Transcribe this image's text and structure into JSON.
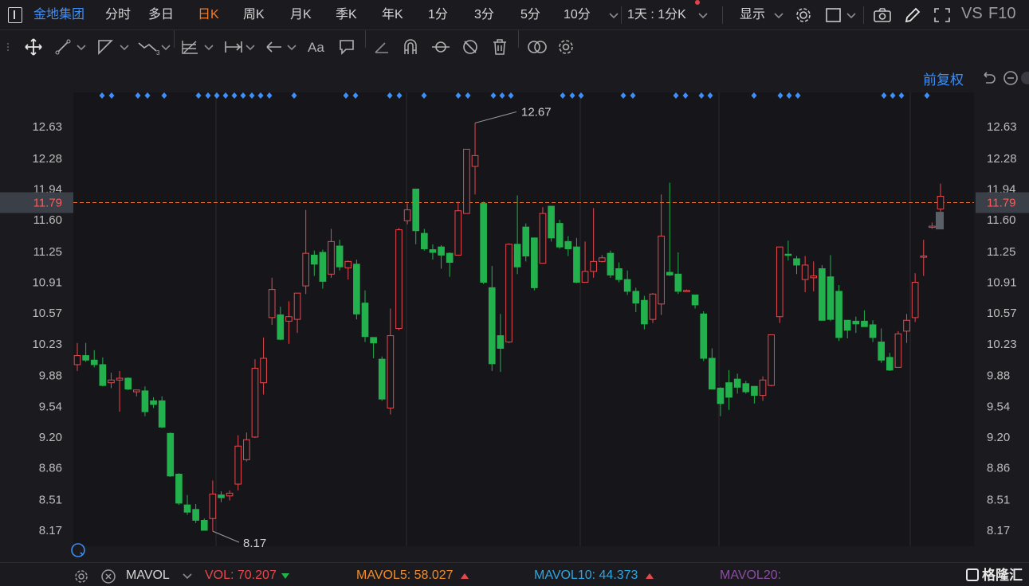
{
  "toolbar": {
    "stock_name": "金地集团",
    "periods": [
      "分时",
      "多日",
      "日K",
      "周K",
      "月K",
      "季K",
      "年K",
      "1分",
      "3分",
      "5分",
      "10分"
    ],
    "active_period": "日K",
    "multi_period": "1天 : 1分K",
    "display_label": "显示",
    "compare_label": "VS",
    "f10_label": "F10"
  },
  "chart_header": {
    "adjust_label": "前复权"
  },
  "chart_data": {
    "type": "candlestick",
    "price_axis_ticks": [
      12.63,
      12.28,
      11.94,
      11.6,
      11.25,
      10.91,
      10.57,
      10.23,
      9.88,
      9.54,
      9.2,
      8.86,
      8.51,
      8.17
    ],
    "ylim": [
      8.17,
      12.63
    ],
    "last_price": "11.79",
    "max_label": "12.67",
    "min_label": "8.17",
    "up_color": "#e5484d",
    "down_color": "#22b14c",
    "candles": [
      [
        10.0,
        10.1,
        9.93,
        10.24
      ],
      [
        10.1,
        10.05,
        10.03,
        10.24
      ],
      [
        10.05,
        10.0,
        9.97,
        10.16
      ],
      [
        10.0,
        9.77,
        9.76,
        10.08
      ],
      [
        9.8,
        9.83,
        9.74,
        9.91
      ],
      [
        9.83,
        9.85,
        9.48,
        9.93
      ],
      [
        9.85,
        9.73,
        9.72,
        9.86
      ],
      [
        9.7,
        9.72,
        9.65,
        9.72
      ],
      [
        9.71,
        9.48,
        9.43,
        9.76
      ],
      [
        9.6,
        9.56,
        9.52,
        9.64
      ],
      [
        9.6,
        9.31,
        9.3,
        9.65
      ],
      [
        9.24,
        8.77,
        8.76,
        9.25
      ],
      [
        8.79,
        8.47,
        8.45,
        8.8
      ],
      [
        8.45,
        8.37,
        8.34,
        8.56
      ],
      [
        8.4,
        8.28,
        8.25,
        8.46
      ],
      [
        8.28,
        8.17,
        8.17,
        8.3
      ],
      [
        8.3,
        8.57,
        8.16,
        8.72
      ],
      [
        8.56,
        8.53,
        8.48,
        8.6
      ],
      [
        8.55,
        8.58,
        8.5,
        8.61
      ],
      [
        8.68,
        9.1,
        8.61,
        9.22
      ],
      [
        8.95,
        9.17,
        8.93,
        9.25
      ],
      [
        9.2,
        9.96,
        9.19,
        10.06
      ],
      [
        9.8,
        10.07,
        9.67,
        10.3
      ],
      [
        10.52,
        10.83,
        10.44,
        10.96
      ],
      [
        10.55,
        10.28,
        10.27,
        10.64
      ],
      [
        10.48,
        10.53,
        10.23,
        10.7
      ],
      [
        10.5,
        10.79,
        10.35,
        10.79
      ],
      [
        10.87,
        11.23,
        10.78,
        11.71
      ],
      [
        11.21,
        11.11,
        10.98,
        11.26
      ],
      [
        11.24,
        10.92,
        10.84,
        11.27
      ],
      [
        11.0,
        11.36,
        10.96,
        11.5
      ],
      [
        11.31,
        11.08,
        11.04,
        11.38
      ],
      [
        11.07,
        11.14,
        10.94,
        11.15
      ],
      [
        11.11,
        10.56,
        10.5,
        11.16
      ],
      [
        10.68,
        10.31,
        10.25,
        10.82
      ],
      [
        10.3,
        10.24,
        10.07,
        10.29
      ],
      [
        10.06,
        9.62,
        9.6,
        10.09
      ],
      [
        9.52,
        10.32,
        9.45,
        10.62
      ],
      [
        10.4,
        11.49,
        10.38,
        11.51
      ],
      [
        11.59,
        11.71,
        11.55,
        11.78
      ],
      [
        11.94,
        11.48,
        11.33,
        11.94
      ],
      [
        11.45,
        11.28,
        11.26,
        11.5
      ],
      [
        11.27,
        11.24,
        11.16,
        11.33
      ],
      [
        11.3,
        11.21,
        11.06,
        11.32
      ],
      [
        11.23,
        11.13,
        10.97,
        11.24
      ],
      [
        11.21,
        11.7,
        11.21,
        11.8
      ],
      [
        11.67,
        12.38,
        11.67,
        12.38
      ],
      [
        12.19,
        12.31,
        11.88,
        12.67
      ],
      [
        11.78,
        10.91,
        10.89,
        11.8
      ],
      [
        10.85,
        10.01,
        9.93,
        11.09
      ],
      [
        10.32,
        10.18,
        9.92,
        10.56
      ],
      [
        10.25,
        11.33,
        10.24,
        11.34
      ],
      [
        11.33,
        11.08,
        11.0,
        11.87
      ],
      [
        11.52,
        11.2,
        11.14,
        11.56
      ],
      [
        11.4,
        10.85,
        10.82,
        11.39
      ],
      [
        11.12,
        11.67,
        11.13,
        11.74
      ],
      [
        11.75,
        11.4,
        11.36,
        11.75
      ],
      [
        11.56,
        11.3,
        11.28,
        11.6
      ],
      [
        11.36,
        11.28,
        11.2,
        11.42
      ],
      [
        11.3,
        10.91,
        10.9,
        11.4
      ],
      [
        10.91,
        11.03,
        10.93,
        11.36
      ],
      [
        11.03,
        11.14,
        10.96,
        11.73
      ],
      [
        11.14,
        11.18,
        11.13,
        11.21
      ],
      [
        11.23,
        10.99,
        10.96,
        11.26
      ],
      [
        11.06,
        10.94,
        10.91,
        11.13
      ],
      [
        10.94,
        10.81,
        10.77,
        11.04
      ],
      [
        10.81,
        10.68,
        10.58,
        10.85
      ],
      [
        10.71,
        10.45,
        10.39,
        10.76
      ],
      [
        10.5,
        10.78,
        10.46,
        10.79
      ],
      [
        10.67,
        11.42,
        10.55,
        11.88
      ],
      [
        11.02,
        10.99,
        10.98,
        12.01
      ],
      [
        11.0,
        10.81,
        10.78,
        11.24
      ],
      [
        10.81,
        10.82,
        10.82,
        10.83
      ],
      [
        10.77,
        10.66,
        10.62,
        10.75
      ],
      [
        10.56,
        10.07,
        10.04,
        10.59
      ],
      [
        10.07,
        9.73,
        9.73,
        10.18
      ],
      [
        9.74,
        9.57,
        9.43,
        9.75
      ],
      [
        9.8,
        9.64,
        9.5,
        9.94
      ],
      [
        9.84,
        9.75,
        9.68,
        9.9
      ],
      [
        9.79,
        9.7,
        9.68,
        9.82
      ],
      [
        9.76,
        9.66,
        9.57,
        9.76
      ],
      [
        9.66,
        9.83,
        9.6,
        9.87
      ],
      [
        9.77,
        10.33,
        9.76,
        10.29
      ],
      [
        10.53,
        11.3,
        10.46,
        11.3
      ],
      [
        11.22,
        11.21,
        11.15,
        11.37
      ],
      [
        11.17,
        11.1,
        11.0,
        11.2
      ],
      [
        10.94,
        11.1,
        10.8,
        11.2
      ],
      [
        10.96,
        10.98,
        10.81,
        11.14
      ],
      [
        11.06,
        10.49,
        10.52,
        11.1
      ],
      [
        10.97,
        10.5,
        10.48,
        11.21
      ],
      [
        10.81,
        10.3,
        10.26,
        10.88
      ],
      [
        10.49,
        10.38,
        10.29,
        10.49
      ],
      [
        10.48,
        10.45,
        10.35,
        10.53
      ],
      [
        10.48,
        10.42,
        10.42,
        10.6
      ],
      [
        10.44,
        10.3,
        10.25,
        10.49
      ],
      [
        10.25,
        10.05,
        10.02,
        10.4
      ],
      [
        10.08,
        9.94,
        9.93,
        10.13
      ],
      [
        9.97,
        10.34,
        9.98,
        10.37
      ],
      [
        10.37,
        10.49,
        10.24,
        10.56
      ],
      [
        10.52,
        10.91,
        10.47,
        11.01
      ],
      [
        11.2,
        11.2,
        10.98,
        11.38
      ],
      [
        11.53,
        11.53,
        11.5,
        11.57
      ],
      [
        11.72,
        11.86,
        11.6,
        12.0
      ]
    ],
    "markers": "blue diamonds above candles"
  },
  "volume": {
    "indicator": "MAVOL",
    "vol_label": "VOL: 70.207",
    "mavol5_label": "MAVOL5: 58.027",
    "mavol10_label": "MAVOL10: 44.373",
    "mavol20_label": "MAVOL20:",
    "vol_color": "#e5484d",
    "mavol5_color": "#f08c2c",
    "mavol10_color": "#2ea6e0",
    "mavol20_color": "#a05fb0"
  },
  "brand": {
    "name": "格隆汇"
  }
}
